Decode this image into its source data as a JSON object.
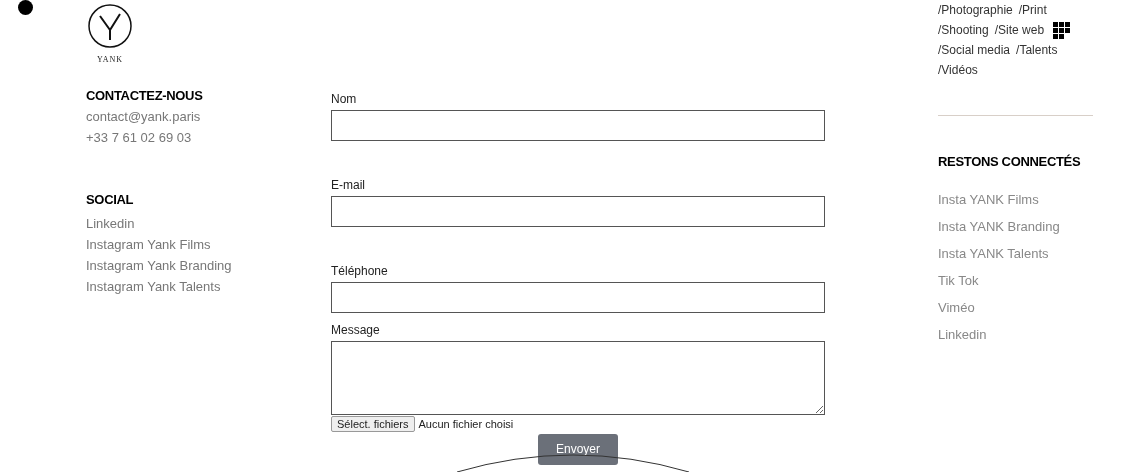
{
  "logo": {
    "wordmark": "YANK"
  },
  "contact": {
    "heading": "CONTACTEZ-NOUS",
    "lines": [
      "contact@yank.paris",
      "+33 7 61 02 69 03"
    ]
  },
  "social": {
    "heading": "SOCIAL",
    "links": [
      "Linkedin",
      "Instagram Yank Films",
      "Instagram Yank Branding",
      "Instagram Yank Talents"
    ]
  },
  "form": {
    "fields": [
      {
        "label": "Nom",
        "kind": "text"
      },
      {
        "label": "E-mail",
        "kind": "text"
      },
      {
        "label": "Téléphone",
        "kind": "text"
      },
      {
        "label": "Message",
        "kind": "textarea"
      }
    ],
    "file_button": "Sélect. fichiers",
    "file_status": "Aucun fichier choisi",
    "submit": "Envoyer"
  },
  "tags": [
    "/Photographie",
    "/Print",
    "/Shooting",
    "/Site web",
    "/Social media",
    "/Talents",
    "/Vidéos"
  ],
  "connect": {
    "heading": "RESTONS CONNECTÉS",
    "links": [
      "Insta YANK Films",
      "Insta YANK Branding",
      "Insta YANK Talents",
      "Tik Tok",
      "Viméo",
      "Linkedin"
    ]
  }
}
